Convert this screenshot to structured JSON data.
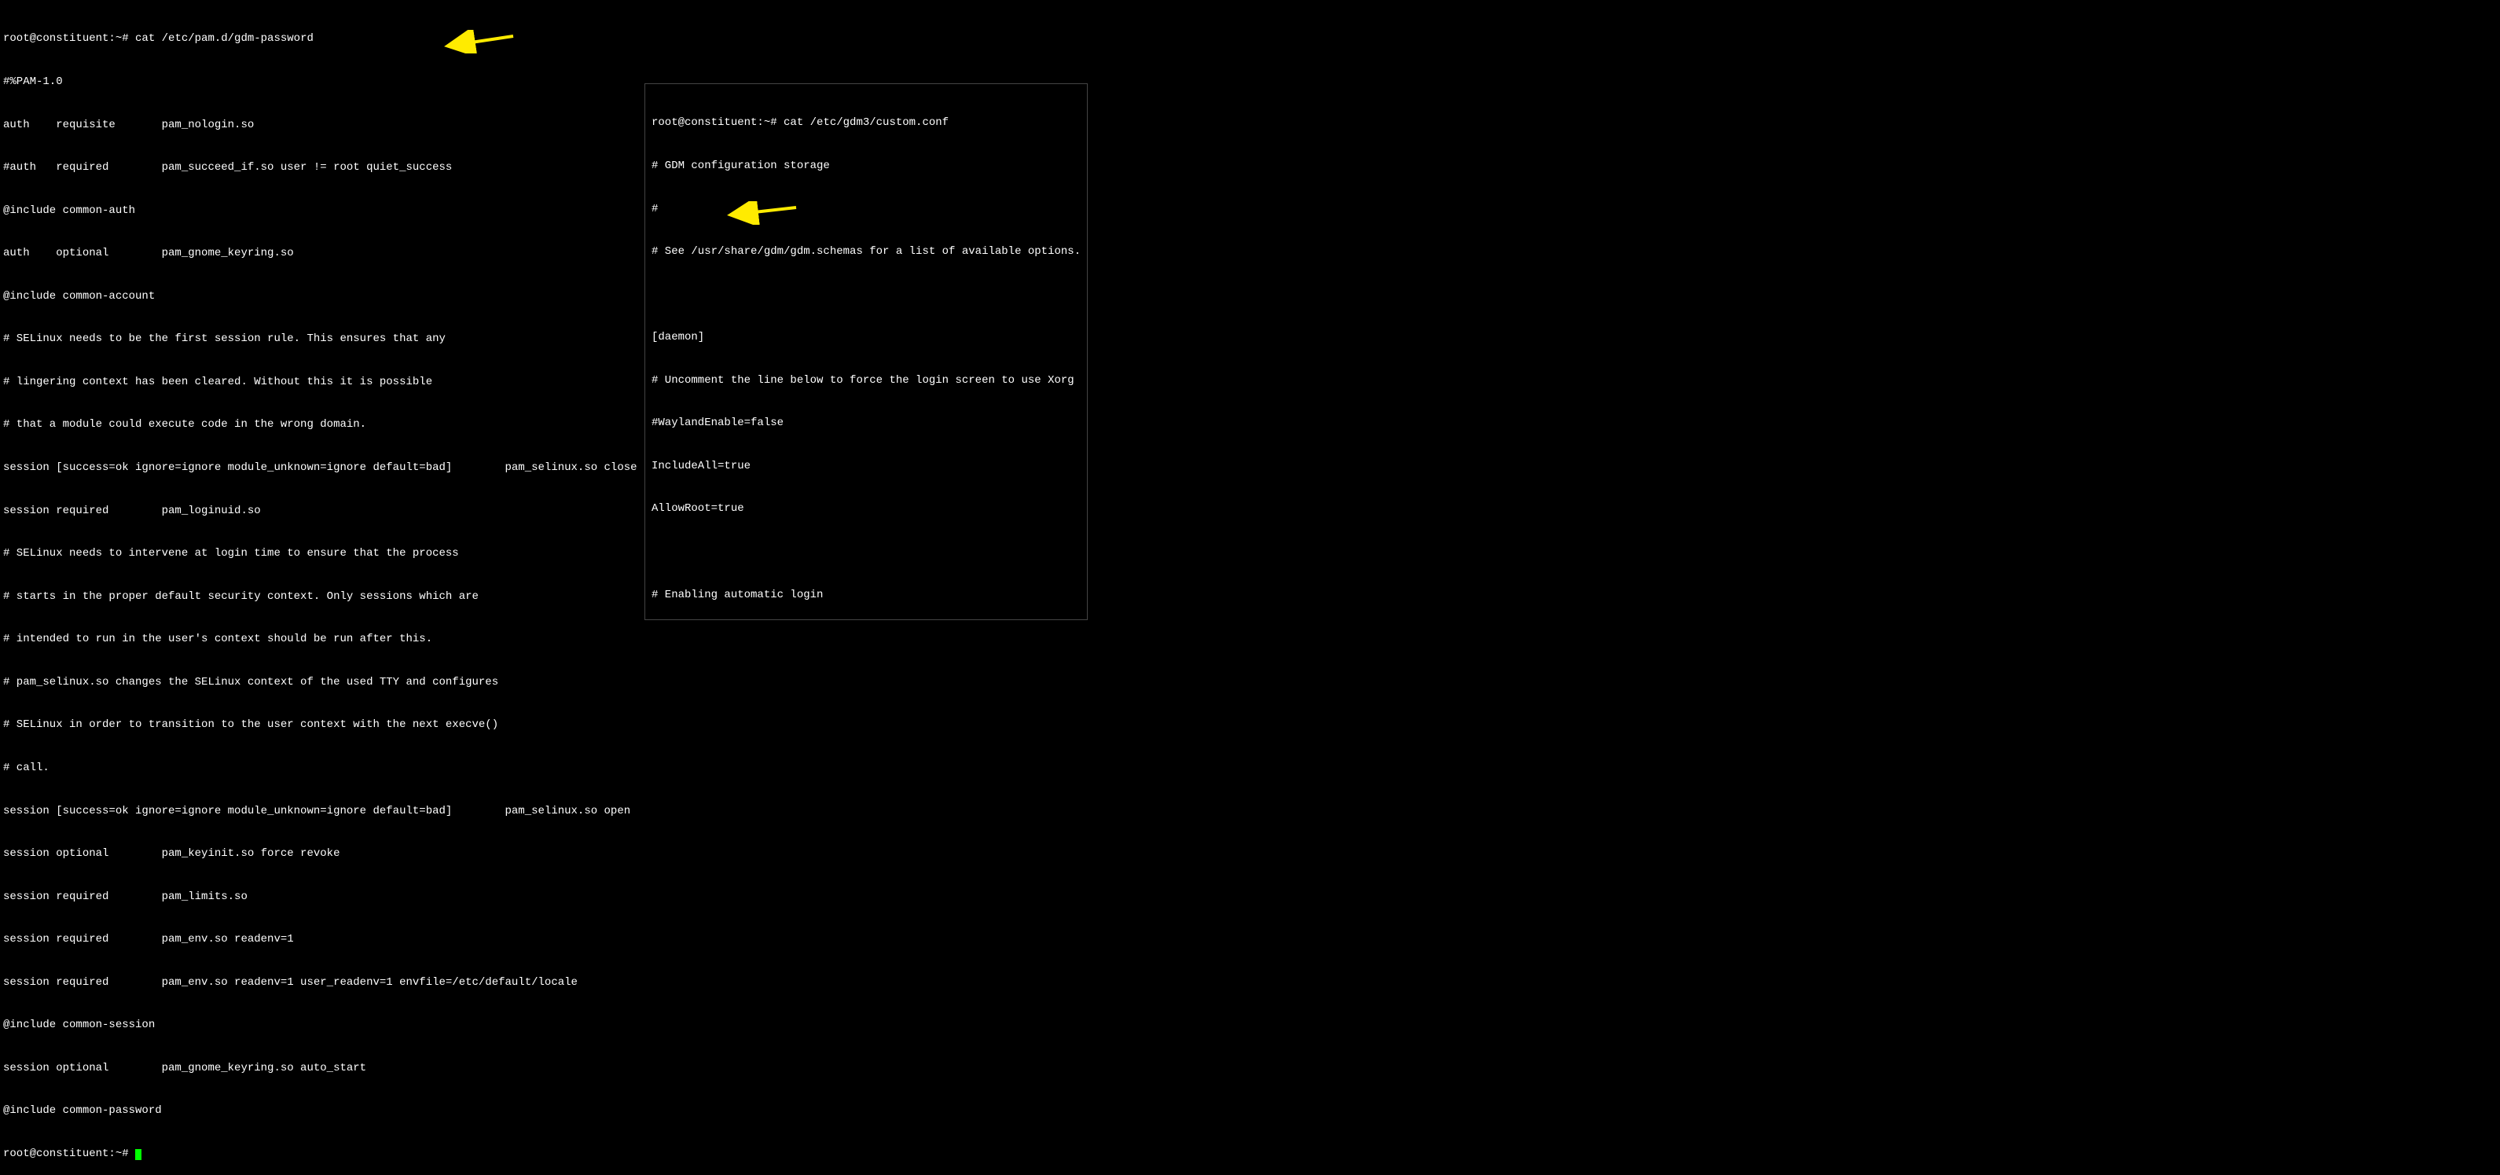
{
  "terminal_left": {
    "prompt_start": "root@constituent:~# ",
    "command1": "cat /etc/pam.d/gdm-password",
    "lines": [
      "#%PAM-1.0",
      "auth    requisite       pam_nologin.so",
      "#auth   required        pam_succeed_if.so user != root quiet_success",
      "@include common-auth",
      "auth    optional        pam_gnome_keyring.so",
      "@include common-account",
      "# SELinux needs to be the first session rule. This ensures that any",
      "# lingering context has been cleared. Without this it is possible",
      "# that a module could execute code in the wrong domain.",
      "session [success=ok ignore=ignore module_unknown=ignore default=bad]        pam_selinux.so close",
      "session required        pam_loginuid.so",
      "# SELinux needs to intervene at login time to ensure that the process",
      "# starts in the proper default security context. Only sessions which are",
      "# intended to run in the user's context should be run after this.",
      "# pam_selinux.so changes the SELinux context of the used TTY and configures",
      "# SELinux in order to transition to the user context with the next execve()",
      "# call.",
      "session [success=ok ignore=ignore module_unknown=ignore default=bad]        pam_selinux.so open",
      "session optional        pam_keyinit.so force revoke",
      "session required        pam_limits.so",
      "session required        pam_env.so readenv=1",
      "session required        pam_env.so readenv=1 user_readenv=1 envfile=/etc/default/locale",
      "@include common-session",
      "session optional        pam_gnome_keyring.so auto_start",
      "@include common-password"
    ],
    "prompt_end": "root@constituent:~# "
  },
  "terminal_right": {
    "prompt": "root@constituent:~# ",
    "command": "cat /etc/gdm3/custom.conf",
    "lines": [
      "# GDM configuration storage",
      "#",
      "# See /usr/share/gdm/gdm.schemas for a list of available options.",
      "",
      "[daemon]",
      "# Uncomment the line below to force the login screen to use Xorg",
      "#WaylandEnable=false",
      "IncludeAll=true",
      "AllowRoot=true",
      "",
      "# Enabling automatic login"
    ]
  },
  "arrow_color": "#ffeb00"
}
